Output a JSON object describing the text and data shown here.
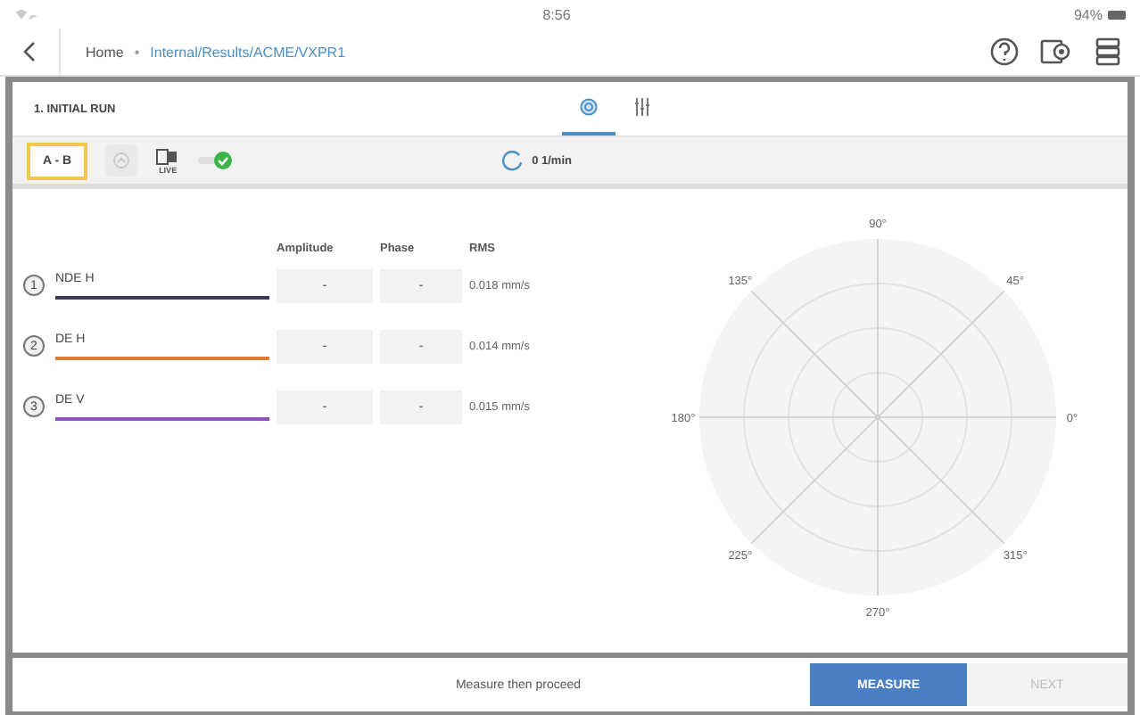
{
  "status_bar": {
    "time": "8:56",
    "battery": "94%"
  },
  "nav": {
    "home": "Home",
    "separator": "•",
    "path": "Internal/Results/ACME/VXPR1"
  },
  "panel": {
    "title": "1. INITIAL RUN",
    "tabs": [
      {
        "kind": "polar",
        "selected": true
      },
      {
        "kind": "sliders",
        "selected": false
      }
    ]
  },
  "toolbar": {
    "mode": "A - B",
    "live_label": "LIVE",
    "connected": true,
    "speed": "0 1/min"
  },
  "table": {
    "columns": [
      "Amplitude",
      "Phase",
      "RMS"
    ],
    "rows": [
      {
        "number": "1",
        "name": "NDE H",
        "color": "#3b3a5c",
        "amplitude": "-",
        "phase": "-",
        "rms": "0.018 mm/s"
      },
      {
        "number": "2",
        "name": "DE H",
        "color": "#e07b39",
        "amplitude": "-",
        "phase": "-",
        "rms": "0.014 mm/s"
      },
      {
        "number": "3",
        "name": "DE V",
        "color": "#8e4fc4",
        "amplitude": "-",
        "phase": "-",
        "rms": "0.015 mm/s"
      }
    ]
  },
  "polar": {
    "labels": [
      "90°",
      "45°",
      "0°",
      "315°",
      "270°",
      "225°",
      "180°",
      "135°"
    ]
  },
  "footer": {
    "hint": "Measure then proceed",
    "measure": "MEASURE",
    "next": {
      "label": "NEXT",
      "disabled": true
    }
  }
}
